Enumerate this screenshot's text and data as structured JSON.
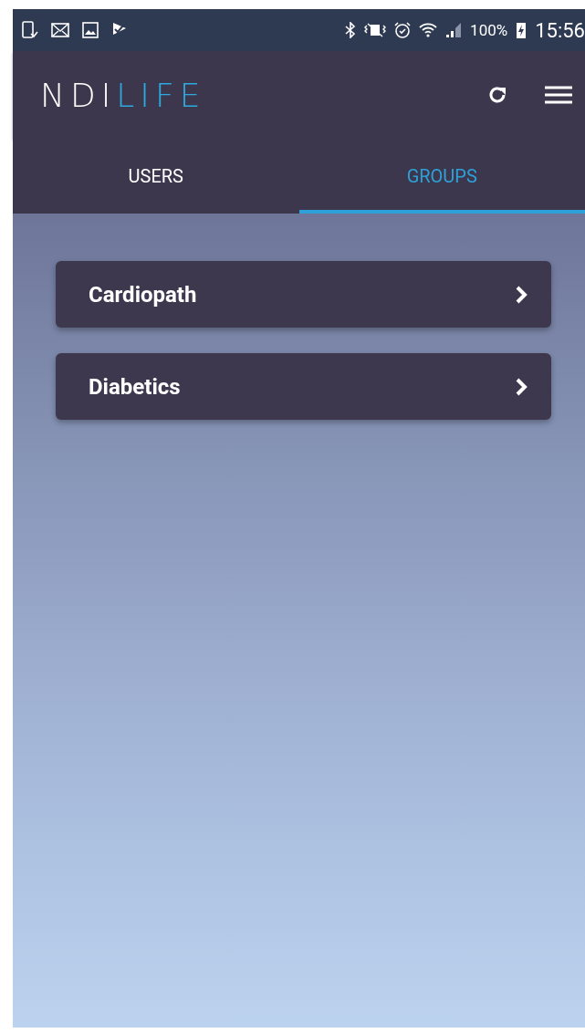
{
  "status_bar": {
    "battery": "100%",
    "time": "15:56"
  },
  "app_bar": {
    "logo": {
      "first": "NDI",
      "second": "LIFE"
    }
  },
  "tabs": [
    {
      "label": "USERS",
      "selected": false
    },
    {
      "label": "GROUPS",
      "selected": true
    }
  ],
  "groups": [
    {
      "name": "Cardiopath"
    },
    {
      "name": "Diabetics"
    }
  ]
}
